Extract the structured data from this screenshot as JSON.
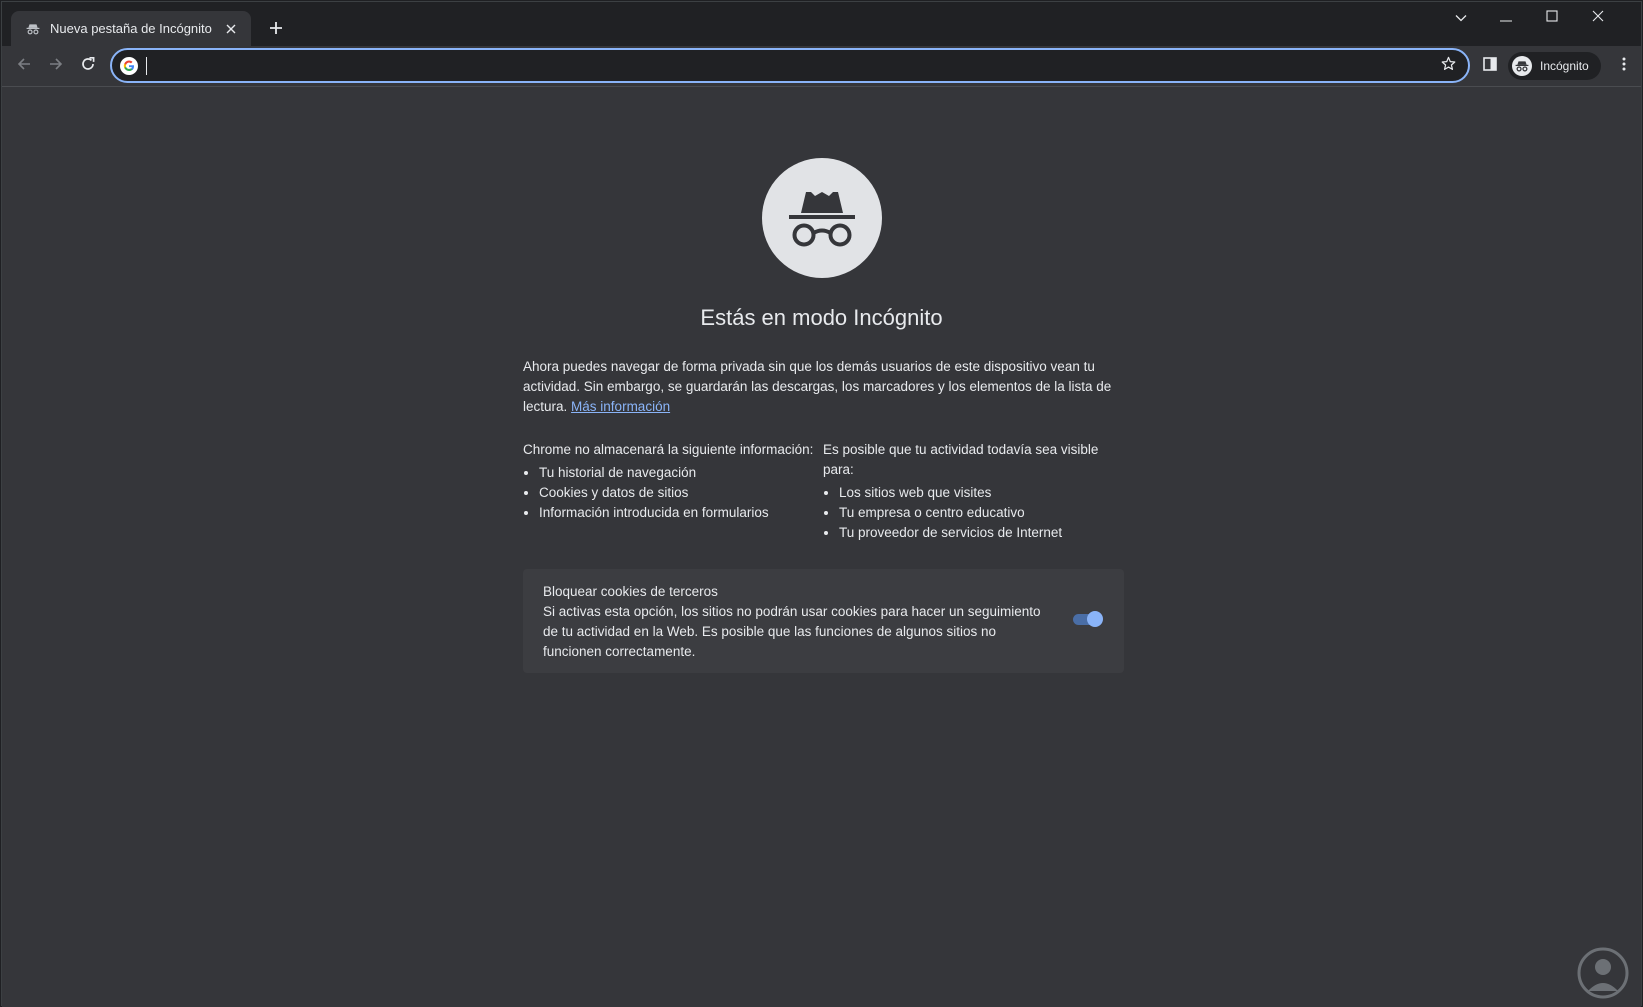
{
  "browser": {
    "tab_title": "Nueva pestaña de Incógnito",
    "omnibox_value": "",
    "profile_label": "Incógnito"
  },
  "page": {
    "heading": "Estás en modo Incógnito",
    "intro_text": "Ahora puedes navegar de forma privada sin que los demás usuarios de este dispositivo vean tu actividad. Sin embargo, se guardarán las descargas, los marcadores y los elementos de la lista de lectura.",
    "learn_more_link": "Más información",
    "not_saved": {
      "header": "Chrome no almacenará la siguiente información:",
      "items": [
        "Tu historial de navegación",
        "Cookies y datos de sitios",
        "Información introducida en formularios"
      ]
    },
    "may_be_visible": {
      "header": "Es posible que tu actividad todavía sea visible para:",
      "items": [
        "Los sitios web que visites",
        "Tu empresa o centro educativo",
        "Tu proveedor de servicios de Internet"
      ]
    },
    "cookie_card": {
      "title": "Bloquear cookies de terceros",
      "description": "Si activas esta opción, los sitios no podrán usar cookies para hacer un seguimiento de tu actividad en la Web. Es posible que las funciones de algunos sitios no funcionen correctamente.",
      "toggle_on": true
    }
  },
  "icons": {
    "tab_icon": "incognito-icon",
    "tab_close": "close-icon",
    "new_tab": "plus-icon",
    "tab_search": "chevron-down-icon",
    "minimize": "minimize-icon",
    "maximize": "maximize-icon",
    "close_window": "close-icon",
    "back": "arrow-left-icon",
    "forward": "arrow-right-icon",
    "reload": "reload-icon",
    "search_engine": "google-icon",
    "bookmark": "star-icon",
    "side_panel": "side-panel-icon",
    "profile": "incognito-icon",
    "menu": "more-vertical-icon",
    "hero": "incognito-icon"
  },
  "colors": {
    "accent": "#8ab4f8",
    "frame": "#202124",
    "surface": "#35363a",
    "card": "#3c3d41"
  }
}
